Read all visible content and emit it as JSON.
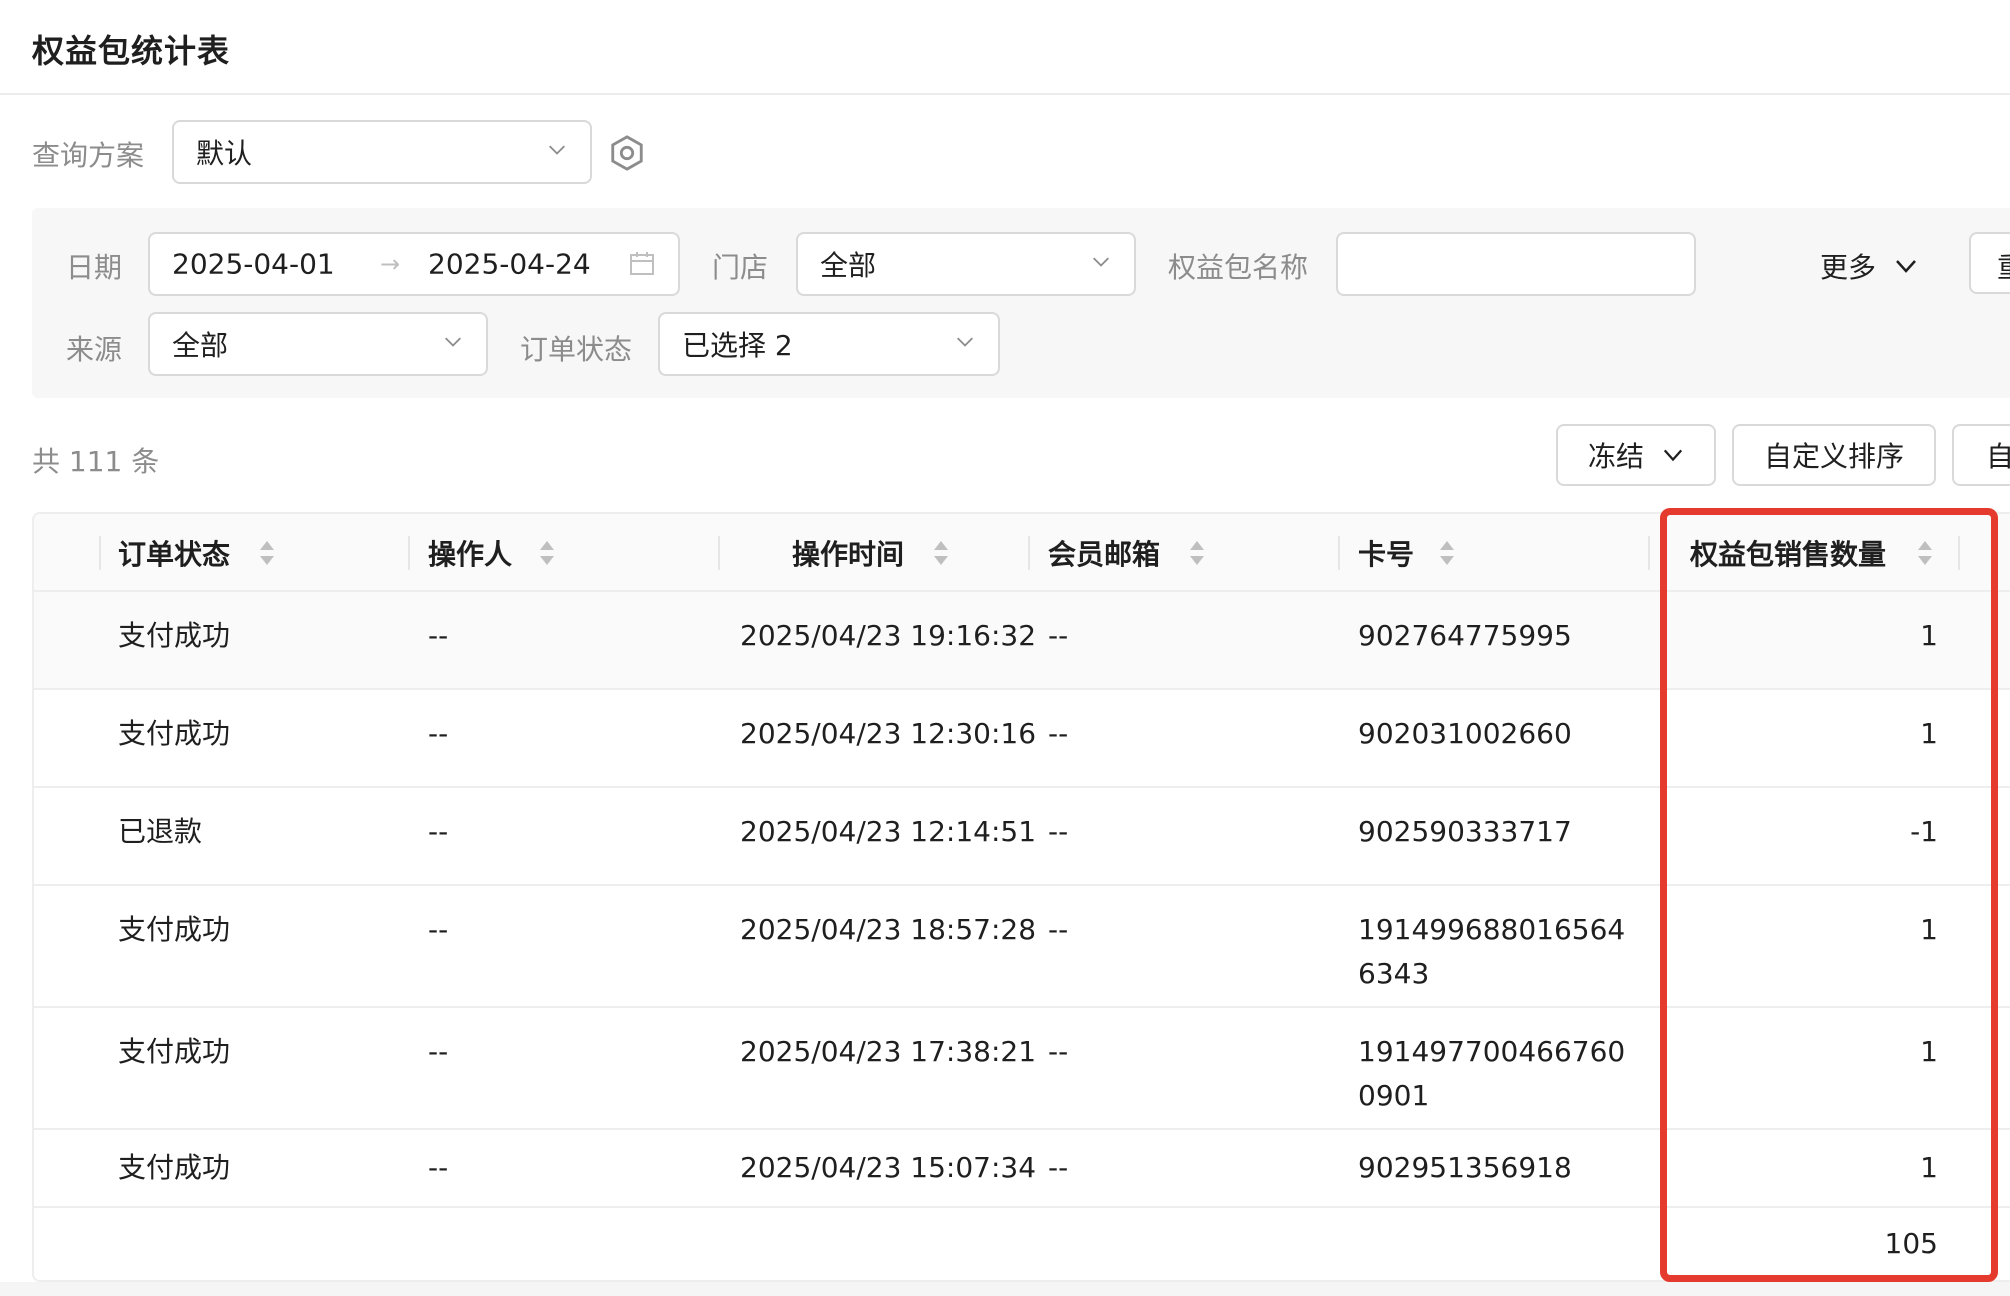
{
  "page": {
    "title": "权益包统计表"
  },
  "query_scheme": {
    "label": "查询方案",
    "value": "默认"
  },
  "filters": {
    "date_label": "日期",
    "date_start": "2025-04-01",
    "date_arrow": "→",
    "date_end": "2025-04-24",
    "store_label": "门店",
    "store_value": "全部",
    "package_name_label": "权益包名称",
    "package_name_value": "",
    "more_label": "更多",
    "cut_button_label": "重",
    "source_label": "来源",
    "source_value": "全部",
    "order_status_label": "订单状态",
    "order_status_value": "已选择 2"
  },
  "toolbar": {
    "total_text": "共 111 条",
    "freeze_label": "冻结",
    "custom_sort_label": "自定义排序",
    "cut_label": "自"
  },
  "table": {
    "columns": [
      "订单状态",
      "操作人",
      "操作时间",
      "会员邮箱",
      "卡号",
      "权益包销售数量"
    ],
    "rows": [
      {
        "status": "支付成功",
        "operator": "--",
        "time": "2025/04/23 19:16:32",
        "email": "--",
        "card": "902764775995",
        "qty": "1"
      },
      {
        "status": "支付成功",
        "operator": "--",
        "time": "2025/04/23 12:30:16",
        "email": "--",
        "card": "902031002660",
        "qty": "1"
      },
      {
        "status": "已退款",
        "operator": "--",
        "time": "2025/04/23 12:14:51",
        "email": "--",
        "card": "902590333717",
        "qty": "-1"
      },
      {
        "status": "支付成功",
        "operator": "--",
        "time": "2025/04/23 18:57:28",
        "email": "--",
        "card": "1914996880165646343",
        "qty": "1"
      },
      {
        "status": "支付成功",
        "operator": "--",
        "time": "2025/04/23 17:38:21",
        "email": "--",
        "card": "1914977004667600901",
        "qty": "1"
      },
      {
        "status": "支付成功",
        "operator": "--",
        "time": "2025/04/23 15:07:34",
        "email": "--",
        "card": "902951356918",
        "qty": "1"
      }
    ],
    "summary_qty": "105"
  },
  "colors": {
    "highlight": "#e53a2e",
    "border": "#d9d9d9",
    "muted_text": "#8c8c8c"
  },
  "icons": {
    "gear": "gear-icon",
    "chevron": "chevron-down-icon",
    "calendar": "calendar-icon",
    "sort": "sort-icon"
  }
}
